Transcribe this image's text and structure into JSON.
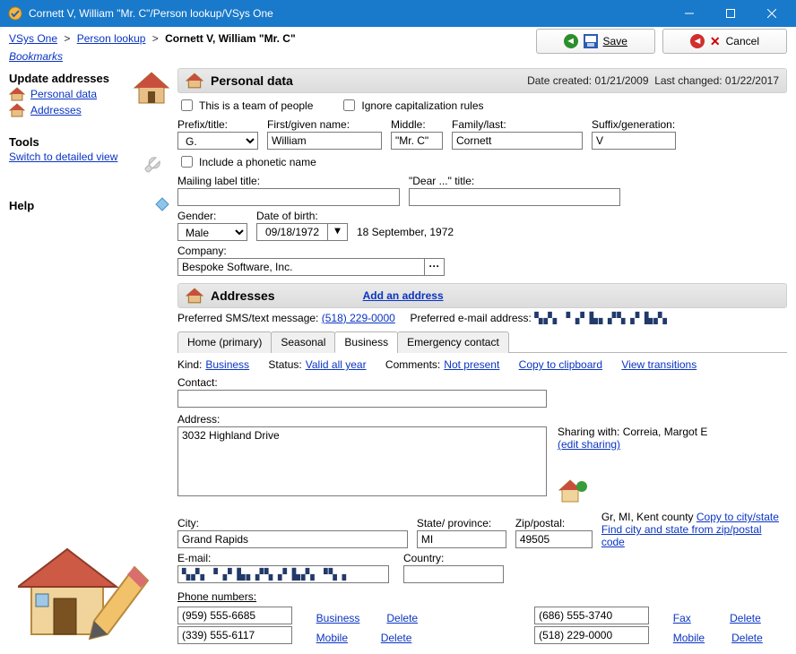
{
  "window": {
    "title": "Cornett V, William \"Mr. C\"/Person lookup/VSys One"
  },
  "breadcrumb": {
    "a": "VSys One",
    "b": "Person lookup",
    "c": "Cornett V, William \"Mr. C\""
  },
  "bookmarks": "Bookmarks",
  "sidebar": {
    "updateHeader": "Update addresses",
    "personalData": "Personal data",
    "addresses": "Addresses",
    "tools": "Tools",
    "switchDetailed": "Switch to detailed view",
    "help": "Help"
  },
  "buttons": {
    "save": "Save",
    "cancel": "Cancel"
  },
  "personal": {
    "header": "Personal data",
    "created": "Date created: 01/21/2009",
    "changed": "Last changed: 01/22/2017",
    "teamChk": "This is a team of people",
    "ignoreCapChk": "Ignore capitalization rules",
    "prefixLabel": "Prefix/title:",
    "prefix": "G.",
    "firstLabel": "First/given name:",
    "first": "William",
    "middleLabel": "Middle:",
    "middle": "\"Mr. C\"",
    "familyLabel": "Family/last:",
    "family": "Cornett",
    "suffixLabel": "Suffix/generation:",
    "suffix": "V",
    "phoneticChk": "Include a phonetic name",
    "mailingLabel": "Mailing label title:",
    "dearLabel": "\"Dear ...\" title:",
    "genderLabel": "Gender:",
    "gender": "Male",
    "dobLabel": "Date of birth:",
    "dob": "09/18/1972",
    "dobLong": "18 September, 1972",
    "companyLabel": "Company:",
    "company": "Bespoke Software, Inc."
  },
  "addresses": {
    "header": "Addresses",
    "addLink": "Add an address",
    "prefSmsLbl": "Preferred SMS/text message:",
    "prefSms": "(518) 229-0000",
    "prefEmailLbl": "Preferred e-mail address:",
    "tabs": {
      "home": "Home (primary)",
      "seasonal": "Seasonal",
      "business": "Business",
      "emergency": "Emergency contact"
    },
    "kindLbl": "Kind:",
    "kind": "Business",
    "statusLbl": "Status:",
    "status": "Valid all year",
    "commentsLbl": "Comments:",
    "comments": "Not present",
    "copy": "Copy to clipboard",
    "viewTrans": "View transitions",
    "contactLbl": "Contact:",
    "addressLbl": "Address:",
    "address": "3032 Highland Drive",
    "sharingLbl": "Sharing with: Correia, Margot E",
    "editSharing": "(edit sharing)",
    "cityLbl": "City:",
    "city": "Grand Rapids",
    "stateLbl": "State/ province:",
    "state": "MI",
    "zipLbl": "Zip/postal:",
    "zip": "49505",
    "locText": "Gr, MI, Kent county",
    "copyCityState": "Copy to city/state",
    "findCity": "Find city and state from zip/postal code",
    "emailLbl": "E-mail:",
    "countryLbl": "Country:",
    "phonesLbl": "Phone numbers:",
    "p1": "(959) 555-6685",
    "p1k": "Business",
    "p2": "(339) 555-6117",
    "p2k": "Mobile",
    "p3": "(686) 555-3740",
    "p3k": "Fax",
    "p4": "(518) 229-0000",
    "p4k": "Mobile",
    "delete": "Delete"
  }
}
